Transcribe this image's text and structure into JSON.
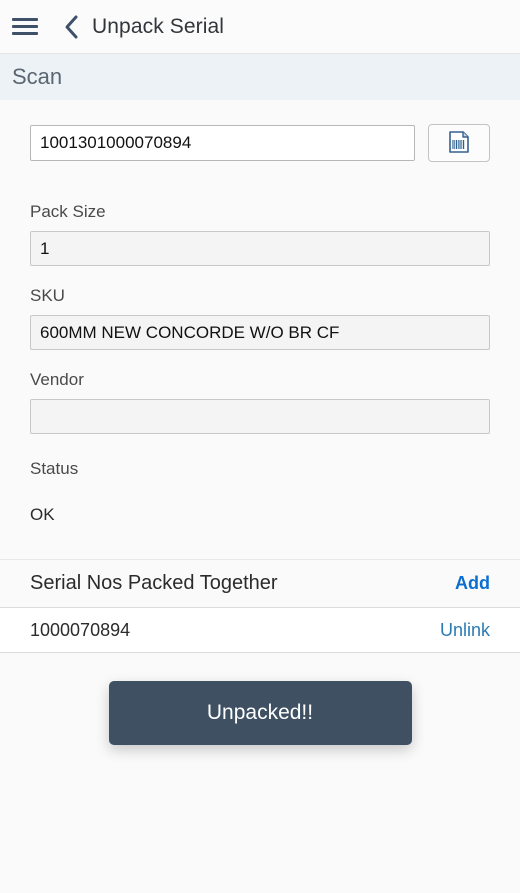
{
  "appbar": {
    "menu_icon": "hamburger-menu-icon",
    "back_icon": "chevron-left-icon",
    "title": "Unpack Serial"
  },
  "section": {
    "scan_title": "Scan"
  },
  "scan": {
    "value": "1001301000070894",
    "placeholder": "",
    "scan_button_icon": "barcode-scanner-icon"
  },
  "fields": {
    "pack_size": {
      "label": "Pack Size",
      "value": "1"
    },
    "sku": {
      "label": "SKU",
      "value": "600MM NEW CONCORDE W/O BR CF"
    },
    "vendor": {
      "label": "Vendor",
      "value": ""
    },
    "status": {
      "label": "Status",
      "value": "OK"
    }
  },
  "serial_list": {
    "title": "Serial Nos Packed Together",
    "add_label": "Add",
    "rows": [
      {
        "serial": "1000070894",
        "action_label": "Unlink"
      }
    ]
  },
  "actions": {
    "primary_label": "Unpacked!!"
  },
  "colors": {
    "accent_link": "#0a6ed1",
    "link": "#2b7bb3",
    "primary_button_bg": "#3e5062",
    "section_header_bg": "#edf2f6",
    "page_bg": "#fafafa"
  }
}
